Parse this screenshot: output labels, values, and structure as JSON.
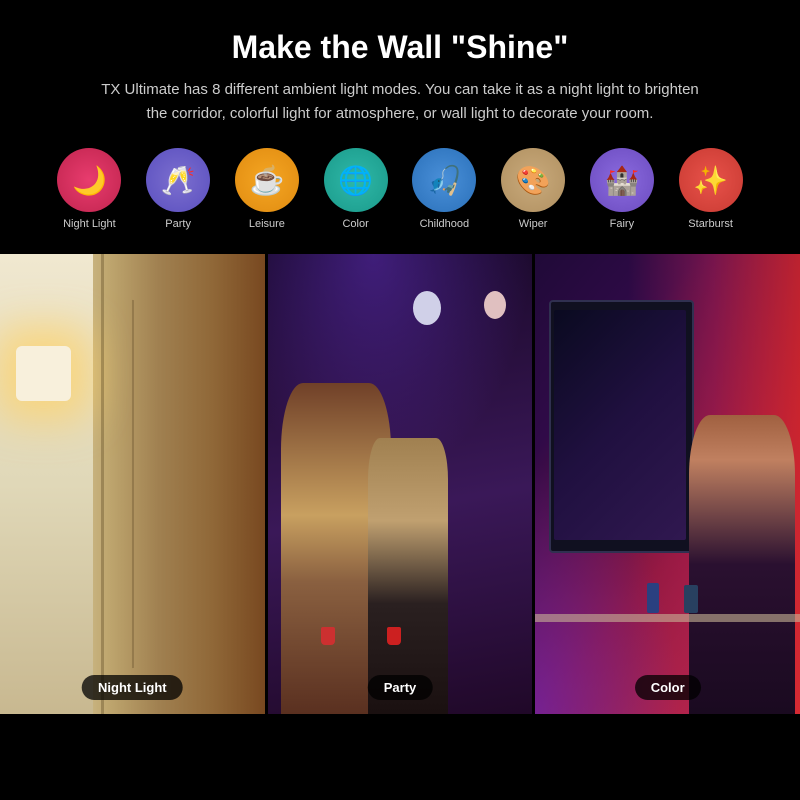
{
  "header": {
    "title": "Make the Wall \"Shine\"",
    "subtitle": "TX Ultimate has 8 different ambient light modes. You can take it as a night light to brighten the corridor, colorful light for atmosphere, or wall light to decorate your room."
  },
  "modes": [
    {
      "id": "night-light",
      "label": "Night Light",
      "icon": "🌙",
      "bg": "bg-pink"
    },
    {
      "id": "party",
      "label": "Party",
      "icon": "🥂",
      "bg": "bg-purple"
    },
    {
      "id": "leisure",
      "label": "Leisure",
      "icon": "☕",
      "bg": "bg-orange"
    },
    {
      "id": "color",
      "label": "Color",
      "icon": "🌐",
      "bg": "bg-teal"
    },
    {
      "id": "childhood",
      "label": "Childhood",
      "icon": "🎣",
      "bg": "bg-blue"
    },
    {
      "id": "wiper",
      "label": "Wiper",
      "icon": "🎨",
      "bg": "bg-tan"
    },
    {
      "id": "fairy",
      "label": "Fairy",
      "icon": "🏰",
      "bg": "bg-violet"
    },
    {
      "id": "starburst",
      "label": "Starburst",
      "icon": "✨",
      "bg": "bg-red"
    }
  ],
  "panels": [
    {
      "id": "panel-night",
      "label": "Night Light"
    },
    {
      "id": "panel-party",
      "label": "Party"
    },
    {
      "id": "panel-color",
      "label": "Color"
    }
  ]
}
